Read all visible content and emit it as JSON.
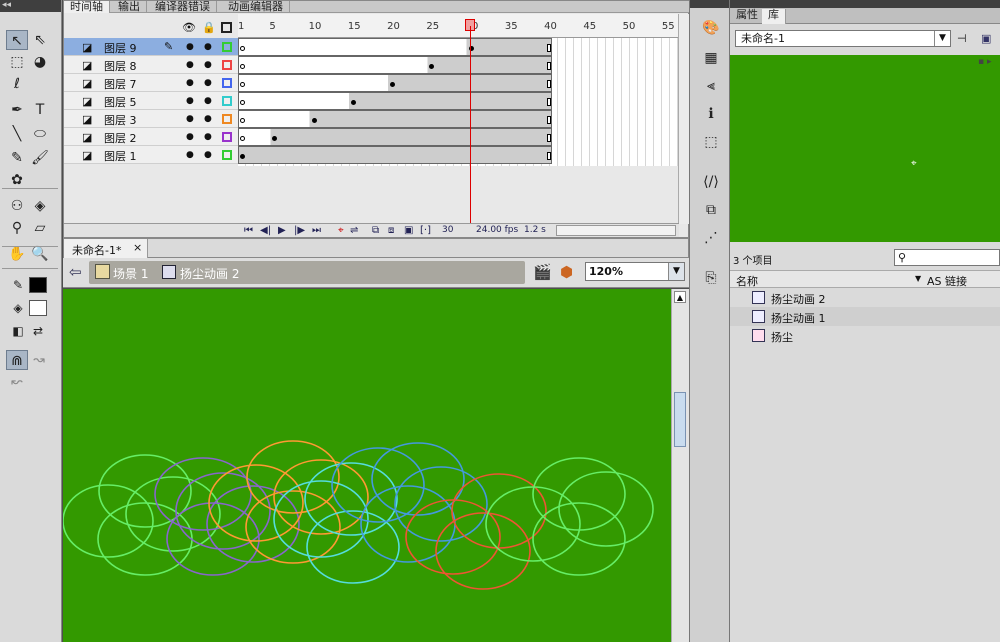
{
  "tools": {
    "collapse": "◂◂",
    "items": [
      {
        "name": "selection-tool-icon",
        "glyph": "↖"
      },
      {
        "name": "subselection-tool-icon",
        "glyph": "⇖"
      },
      {
        "name": "free-transform-tool-icon",
        "glyph": "⬚"
      },
      {
        "name": "3d-rotation-tool-icon",
        "glyph": "◕"
      },
      {
        "name": "lasso-tool-icon",
        "glyph": "ℓ"
      },
      {
        "name": "pen-tool-icon",
        "glyph": "✒"
      },
      {
        "name": "text-tool-icon",
        "glyph": "T"
      },
      {
        "name": "line-tool-icon",
        "glyph": "╲"
      },
      {
        "name": "oval-tool-icon",
        "glyph": "⬭"
      },
      {
        "name": "pencil-tool-icon",
        "glyph": "✎"
      },
      {
        "name": "brush-tool-icon",
        "glyph": "🖌"
      },
      {
        "name": "deco-tool-icon",
        "glyph": "✿"
      },
      {
        "name": "bone-tool-icon",
        "glyph": "⚇"
      },
      {
        "name": "paint-bucket-tool-icon",
        "glyph": "◈"
      },
      {
        "name": "eyedropper-tool-icon",
        "glyph": "⚲"
      },
      {
        "name": "eraser-tool-icon",
        "glyph": "▱"
      },
      {
        "name": "hand-tool-icon",
        "glyph": "✋"
      },
      {
        "name": "zoom-tool-icon",
        "glyph": "🔍"
      }
    ]
  },
  "timeline": {
    "tabs": [
      "时间轴",
      "输出",
      "编译器错误",
      "动画编辑器"
    ],
    "layers": [
      {
        "name": "图层 9",
        "color": "#33cc33",
        "selected": true
      },
      {
        "name": "图层 8",
        "color": "#ee4444"
      },
      {
        "name": "图层 7",
        "color": "#4466ee"
      },
      {
        "name": "图层 5",
        "color": "#33cccc"
      },
      {
        "name": "图层 3",
        "color": "#ee8822"
      },
      {
        "name": "图层 2",
        "color": "#9933cc"
      },
      {
        "name": "图层 1",
        "color": "#33cc33"
      }
    ],
    "ruler_numbers": [
      "1",
      "5",
      "10",
      "15",
      "20",
      "25",
      "30",
      "35",
      "40",
      "45",
      "50",
      "55"
    ],
    "status": {
      "frame": "30",
      "fps": "24.00 fps",
      "time": "1.2 s"
    },
    "layer_toolbar": [
      "new-layer-icon",
      "new-folder-icon",
      "delete-layer-icon"
    ]
  },
  "document": {
    "tab_label": "未命名-1*",
    "tab_close": "×",
    "scene": "场景 1",
    "symbol": "扬尘动画 2",
    "zoom": "120%"
  },
  "panels": {
    "tabs": [
      "属性",
      "库"
    ],
    "library_select": "未命名-1",
    "item_count": "3 个项目",
    "col_name": "名称",
    "col_link": "AS 链接",
    "items": [
      {
        "name": "扬尘动画 2",
        "type": "movieclip",
        "selected": false
      },
      {
        "name": "扬尘动画 1",
        "type": "movieclip",
        "selected": true
      },
      {
        "name": "扬尘",
        "type": "graphic",
        "selected": false
      }
    ]
  },
  "colors": {
    "stage": "#339900",
    "selected_layer": "#8caee0",
    "playhead": "#dd0000"
  }
}
